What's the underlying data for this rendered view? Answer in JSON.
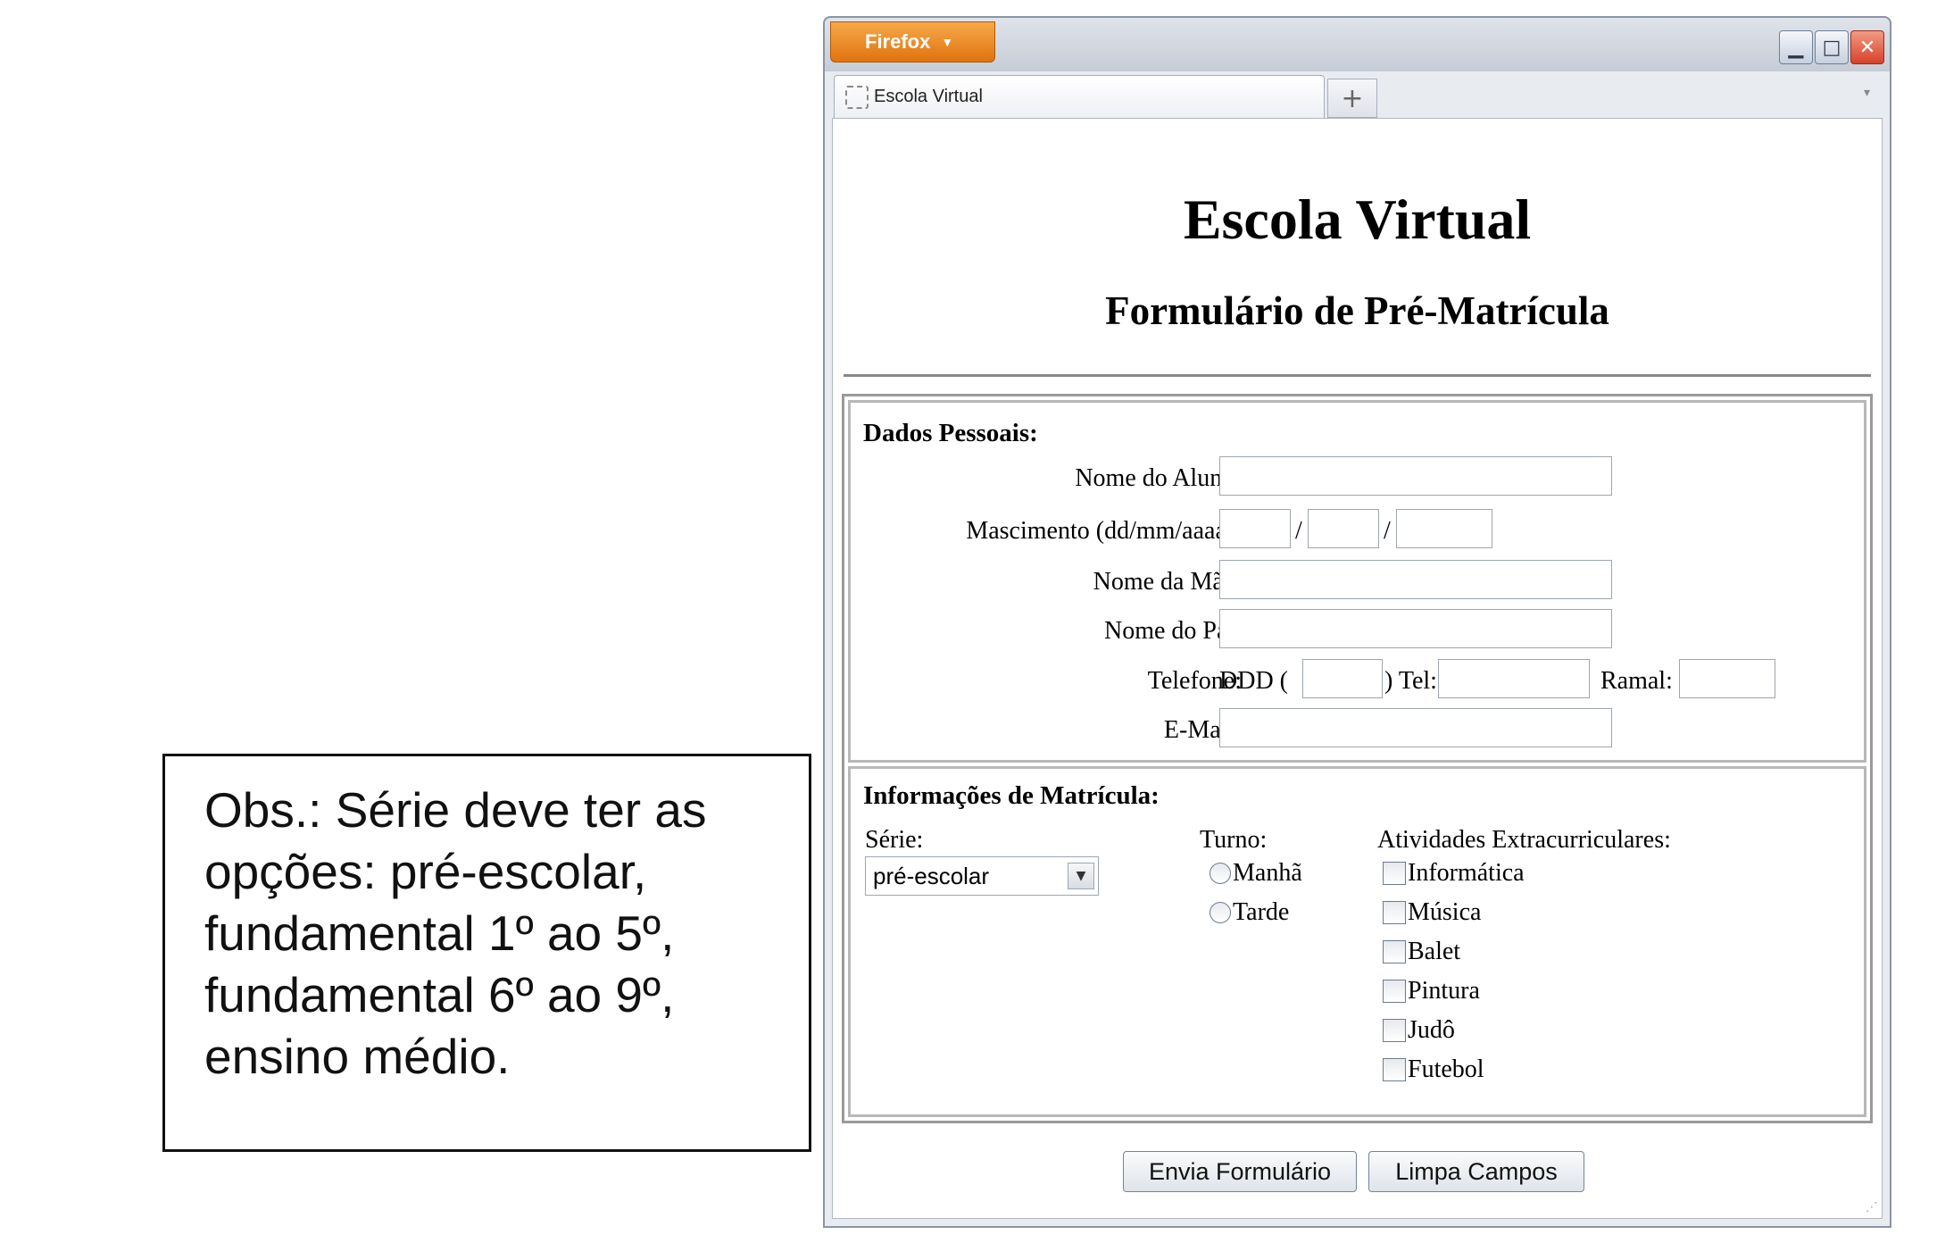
{
  "note": {
    "text_lines": [
      "Obs.: Série deve ter as",
      "opções: pré-escolar,",
      "fundamental 1º ao 5º,",
      "fundamental 6º ao 9º,",
      "ensino médio."
    ]
  },
  "browser": {
    "menu_label": "Firefox",
    "tab_title": "Escola Virtual",
    "new_tab_label": "+"
  },
  "page": {
    "title": "Escola Virtual",
    "subtitle": "Formulário de Pré-Matrícula"
  },
  "dados_pessoais": {
    "legend": "Dados Pessoais:",
    "nome_aluno_label": "Nome do Aluno:",
    "nascimento_label": "Mascimento (dd/mm/aaaa):",
    "date_separator": "/",
    "nome_mae_label": "Nome da Mãe:",
    "nome_pai_label": "Nome do Pai:",
    "telefone_label": "Telefone:",
    "ddd_prefix": "DDD (",
    "tel_prefix": ") Tel:",
    "ramal_label": "Ramal:",
    "email_label": "E-Mail:"
  },
  "matricula": {
    "legend": "Informações de Matrícula:",
    "serie_label": "Série:",
    "serie_selected": "pré-escolar",
    "turno_label": "Turno:",
    "turno_options": [
      "Manhã",
      "Tarde"
    ],
    "atividades_label": "Atividades Extracurriculares:",
    "atividades": [
      "Informática",
      "Música",
      "Balet",
      "Pintura",
      "Judô",
      "Futebol"
    ]
  },
  "buttons": {
    "submit": "Envia Formulário",
    "reset": "Limpa Campos"
  }
}
